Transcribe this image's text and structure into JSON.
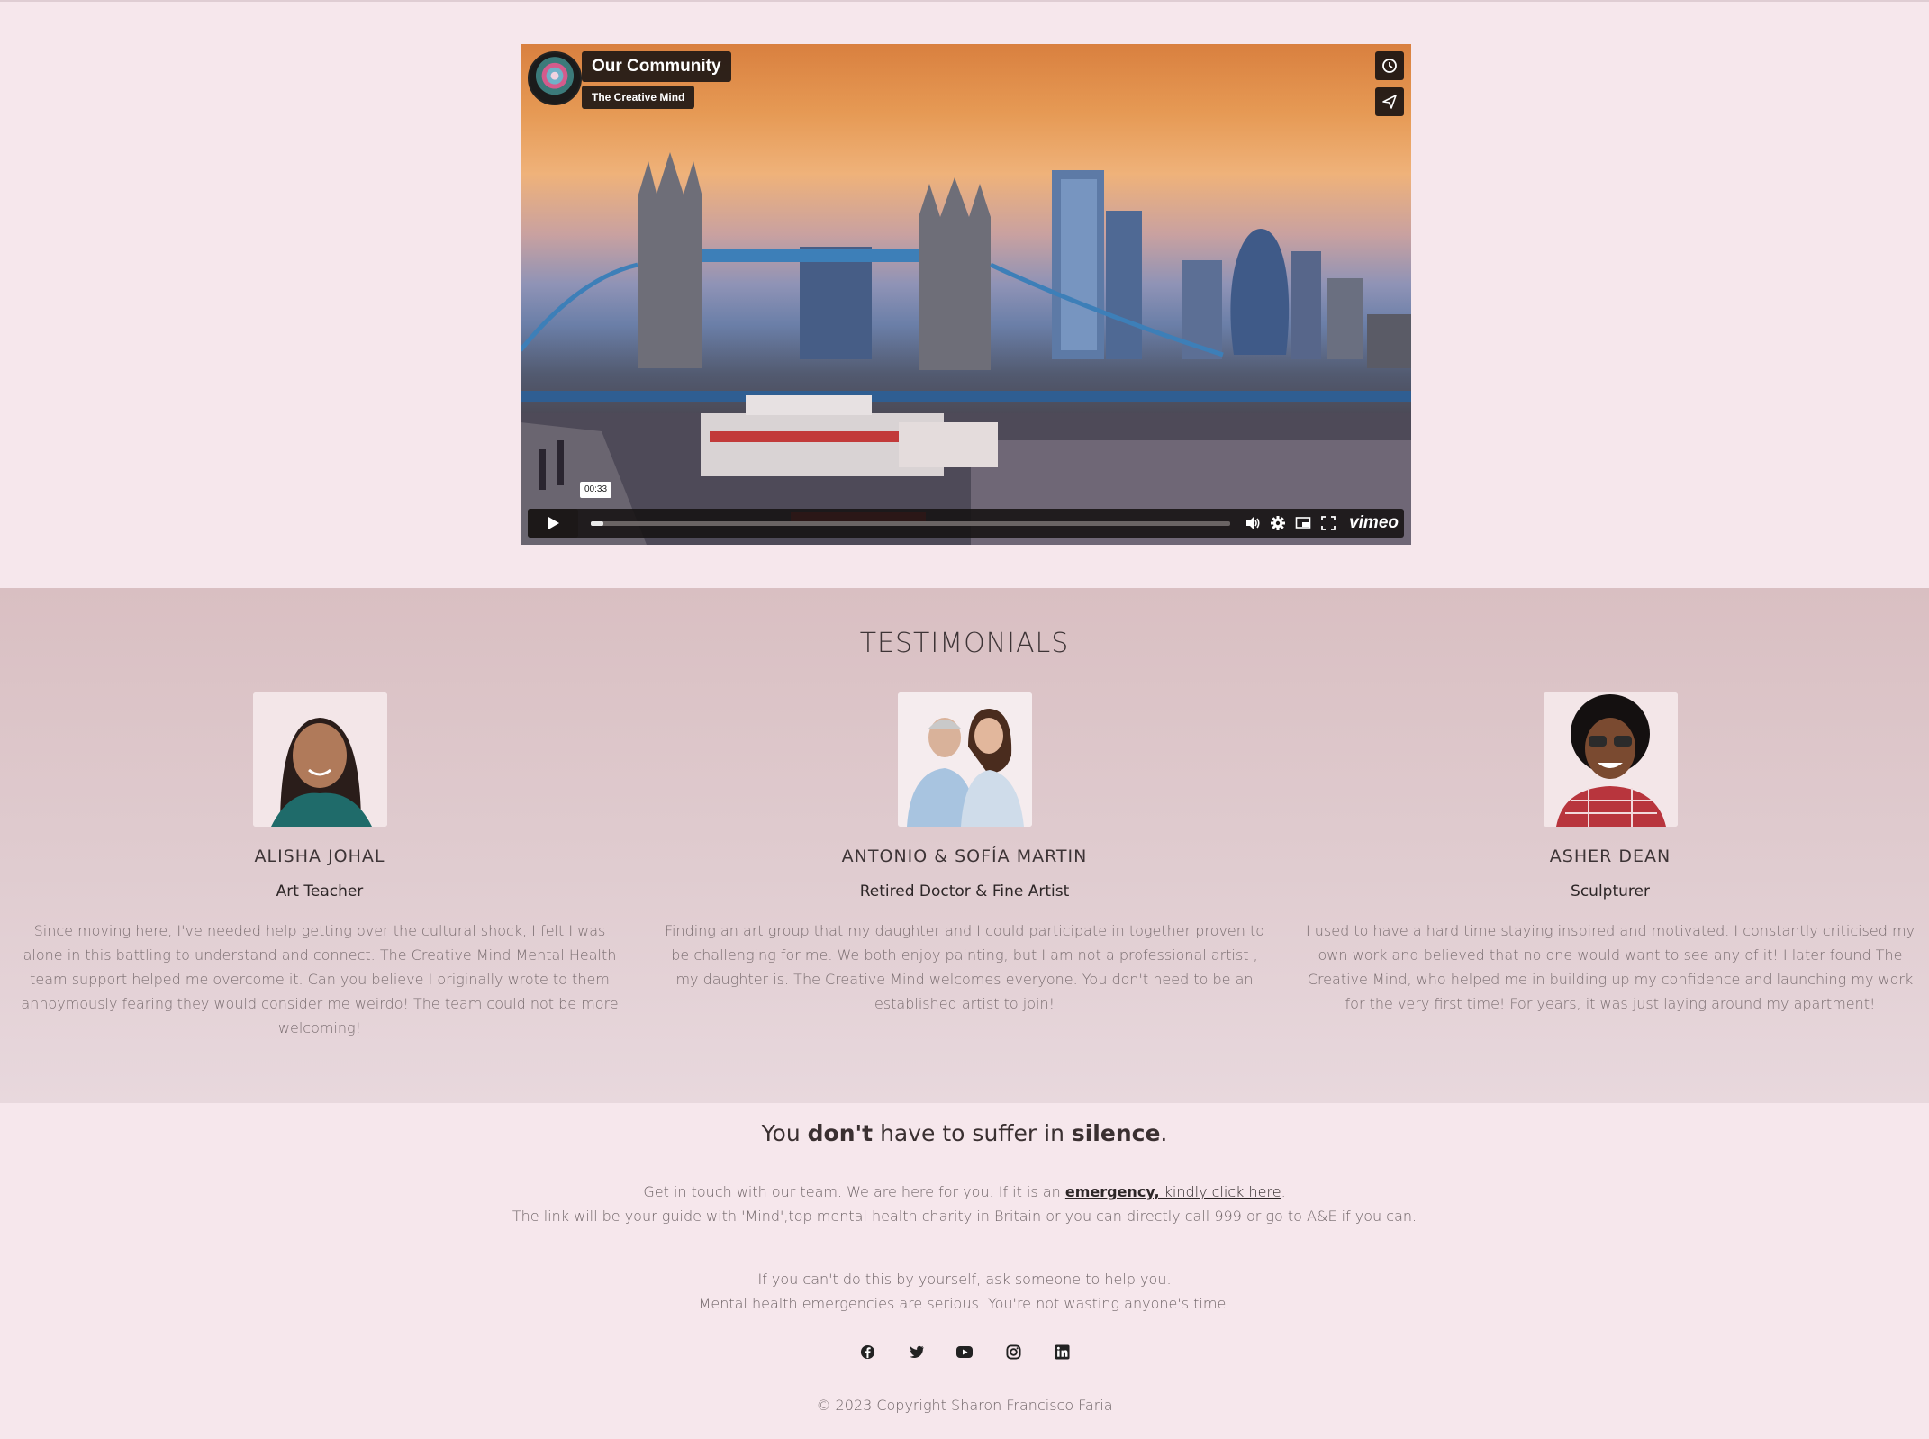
{
  "video": {
    "title": "Our Community",
    "byline": "The Creative Mind",
    "timestamp": "00:33",
    "progress": 0.02,
    "brand": "vimeo"
  },
  "testimonials": {
    "heading": "TESTIMONIALS",
    "items": [
      {
        "name": "ALISHA JOHAL",
        "role": "Art Teacher",
        "text": "Since moving here, I've needed help getting over the cultural shock, I felt I was alone in this battling to understand and connect. The Creative Mind Mental Health team support helped me overcome it. Can you believe I originally wrote to them annoymously fearing they would consider me weirdo! The team could not be more welcoming!"
      },
      {
        "name": "ANTONIO & SOFÍA MARTIN",
        "role": "Retired Doctor & Fine Artist",
        "text": "Finding an art group that my daughter and I could participate in together proven to be challenging for me. We both enjoy painting, but I am not a professional artist , my daughter is. The Creative Mind welcomes everyone. You don't need to be an established artist to join!"
      },
      {
        "name": "ASHER DEAN",
        "role": "Sculpturer",
        "text": "I used to have a hard time staying inspired and motivated. I constantly criticised my own work and believed that no one would want to see any of it! I later found The Creative Mind, who helped me in building up my confidence and launching my work for the very first time! For years, it was just laying around my apartment!"
      }
    ]
  },
  "cta": {
    "headline_1": "You ",
    "headline_bold_1": "don't",
    "headline_2": " have to suffer in ",
    "headline_bold_2": "silence",
    "headline_3": ".",
    "line1_pre": "Get in touch with our team. We are here for you. If it is an ",
    "line1_link_bold": "emergency,",
    "line1_link_rest": " kindly click here",
    "line1_post": ".",
    "line2": "The link will be your guide with 'Mind',top mental health charity in Britain or you can directly call 999 or go to A&E if you can.",
    "line3": "If you can't do this by yourself, ask someone to help you.",
    "line4": "Mental health emergencies are serious. You're not wasting anyone's time."
  },
  "social": [
    "facebook-icon",
    "twitter-icon",
    "youtube-icon",
    "instagram-icon",
    "linkedin-icon"
  ],
  "footer": {
    "copyright": "© 2023 Copyright Sharon Francisco Faria"
  }
}
